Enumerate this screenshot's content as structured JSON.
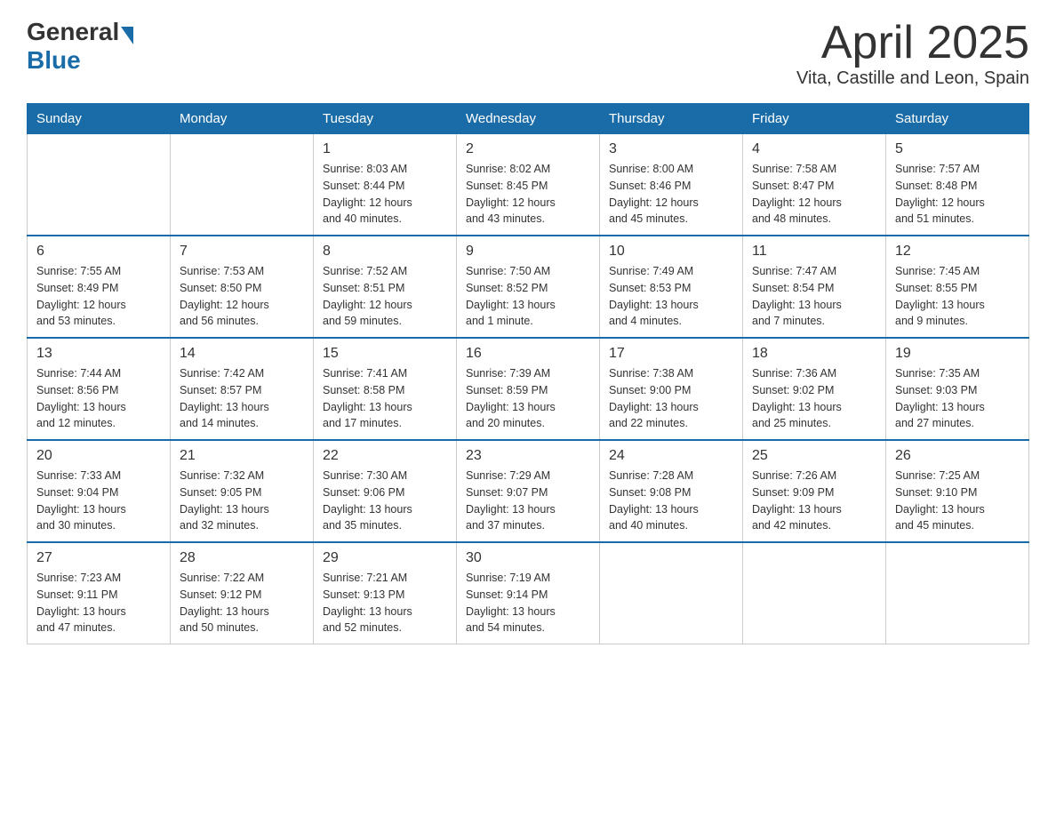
{
  "header": {
    "logo": {
      "general": "General",
      "blue": "Blue"
    },
    "title": "April 2025",
    "location": "Vita, Castille and Leon, Spain"
  },
  "weekdays": [
    "Sunday",
    "Monday",
    "Tuesday",
    "Wednesday",
    "Thursday",
    "Friday",
    "Saturday"
  ],
  "weeks": [
    [
      {
        "day": "",
        "info": ""
      },
      {
        "day": "",
        "info": ""
      },
      {
        "day": "1",
        "info": "Sunrise: 8:03 AM\nSunset: 8:44 PM\nDaylight: 12 hours\nand 40 minutes."
      },
      {
        "day": "2",
        "info": "Sunrise: 8:02 AM\nSunset: 8:45 PM\nDaylight: 12 hours\nand 43 minutes."
      },
      {
        "day": "3",
        "info": "Sunrise: 8:00 AM\nSunset: 8:46 PM\nDaylight: 12 hours\nand 45 minutes."
      },
      {
        "day": "4",
        "info": "Sunrise: 7:58 AM\nSunset: 8:47 PM\nDaylight: 12 hours\nand 48 minutes."
      },
      {
        "day": "5",
        "info": "Sunrise: 7:57 AM\nSunset: 8:48 PM\nDaylight: 12 hours\nand 51 minutes."
      }
    ],
    [
      {
        "day": "6",
        "info": "Sunrise: 7:55 AM\nSunset: 8:49 PM\nDaylight: 12 hours\nand 53 minutes."
      },
      {
        "day": "7",
        "info": "Sunrise: 7:53 AM\nSunset: 8:50 PM\nDaylight: 12 hours\nand 56 minutes."
      },
      {
        "day": "8",
        "info": "Sunrise: 7:52 AM\nSunset: 8:51 PM\nDaylight: 12 hours\nand 59 minutes."
      },
      {
        "day": "9",
        "info": "Sunrise: 7:50 AM\nSunset: 8:52 PM\nDaylight: 13 hours\nand 1 minute."
      },
      {
        "day": "10",
        "info": "Sunrise: 7:49 AM\nSunset: 8:53 PM\nDaylight: 13 hours\nand 4 minutes."
      },
      {
        "day": "11",
        "info": "Sunrise: 7:47 AM\nSunset: 8:54 PM\nDaylight: 13 hours\nand 7 minutes."
      },
      {
        "day": "12",
        "info": "Sunrise: 7:45 AM\nSunset: 8:55 PM\nDaylight: 13 hours\nand 9 minutes."
      }
    ],
    [
      {
        "day": "13",
        "info": "Sunrise: 7:44 AM\nSunset: 8:56 PM\nDaylight: 13 hours\nand 12 minutes."
      },
      {
        "day": "14",
        "info": "Sunrise: 7:42 AM\nSunset: 8:57 PM\nDaylight: 13 hours\nand 14 minutes."
      },
      {
        "day": "15",
        "info": "Sunrise: 7:41 AM\nSunset: 8:58 PM\nDaylight: 13 hours\nand 17 minutes."
      },
      {
        "day": "16",
        "info": "Sunrise: 7:39 AM\nSunset: 8:59 PM\nDaylight: 13 hours\nand 20 minutes."
      },
      {
        "day": "17",
        "info": "Sunrise: 7:38 AM\nSunset: 9:00 PM\nDaylight: 13 hours\nand 22 minutes."
      },
      {
        "day": "18",
        "info": "Sunrise: 7:36 AM\nSunset: 9:02 PM\nDaylight: 13 hours\nand 25 minutes."
      },
      {
        "day": "19",
        "info": "Sunrise: 7:35 AM\nSunset: 9:03 PM\nDaylight: 13 hours\nand 27 minutes."
      }
    ],
    [
      {
        "day": "20",
        "info": "Sunrise: 7:33 AM\nSunset: 9:04 PM\nDaylight: 13 hours\nand 30 minutes."
      },
      {
        "day": "21",
        "info": "Sunrise: 7:32 AM\nSunset: 9:05 PM\nDaylight: 13 hours\nand 32 minutes."
      },
      {
        "day": "22",
        "info": "Sunrise: 7:30 AM\nSunset: 9:06 PM\nDaylight: 13 hours\nand 35 minutes."
      },
      {
        "day": "23",
        "info": "Sunrise: 7:29 AM\nSunset: 9:07 PM\nDaylight: 13 hours\nand 37 minutes."
      },
      {
        "day": "24",
        "info": "Sunrise: 7:28 AM\nSunset: 9:08 PM\nDaylight: 13 hours\nand 40 minutes."
      },
      {
        "day": "25",
        "info": "Sunrise: 7:26 AM\nSunset: 9:09 PM\nDaylight: 13 hours\nand 42 minutes."
      },
      {
        "day": "26",
        "info": "Sunrise: 7:25 AM\nSunset: 9:10 PM\nDaylight: 13 hours\nand 45 minutes."
      }
    ],
    [
      {
        "day": "27",
        "info": "Sunrise: 7:23 AM\nSunset: 9:11 PM\nDaylight: 13 hours\nand 47 minutes."
      },
      {
        "day": "28",
        "info": "Sunrise: 7:22 AM\nSunset: 9:12 PM\nDaylight: 13 hours\nand 50 minutes."
      },
      {
        "day": "29",
        "info": "Sunrise: 7:21 AM\nSunset: 9:13 PM\nDaylight: 13 hours\nand 52 minutes."
      },
      {
        "day": "30",
        "info": "Sunrise: 7:19 AM\nSunset: 9:14 PM\nDaylight: 13 hours\nand 54 minutes."
      },
      {
        "day": "",
        "info": ""
      },
      {
        "day": "",
        "info": ""
      },
      {
        "day": "",
        "info": ""
      }
    ]
  ]
}
